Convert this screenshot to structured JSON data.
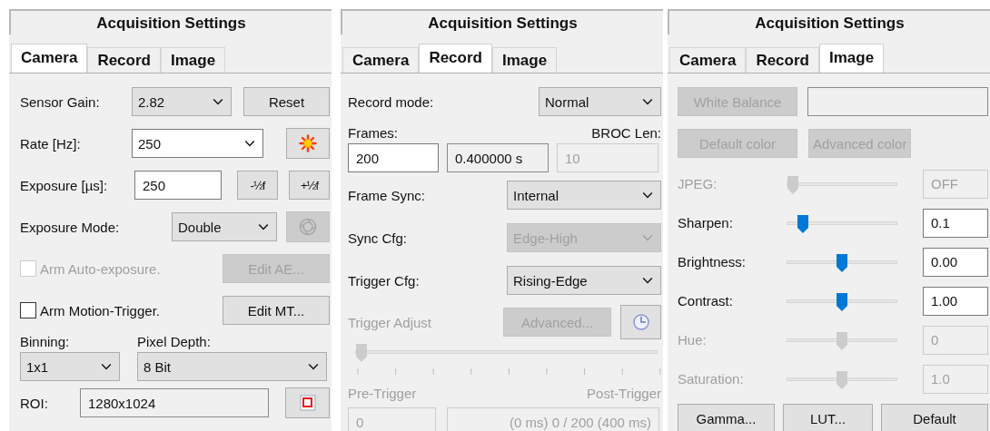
{
  "panels": [
    {
      "kind": "camera",
      "title": "Acquisition Settings",
      "tabs": [
        {
          "label": "Camera",
          "selected": true
        },
        {
          "label": "Record",
          "selected": false
        },
        {
          "label": "Image",
          "selected": false
        }
      ],
      "sensor_gain": {
        "label": "Sensor Gain:",
        "value": "2.82"
      },
      "reset_button": {
        "label": "Reset",
        "disabled": false
      },
      "rate": {
        "label": "Rate [Hz]:",
        "value": "250"
      },
      "exposure": {
        "label": "Exposure [µs]:",
        "value": "250"
      },
      "exposure_minus_button": {
        "label": "-½f",
        "disabled": false
      },
      "exposure_plus_button": {
        "label": "+½f",
        "disabled": false
      },
      "exposure_mode": {
        "label": "Exposure Mode:",
        "value": "Double"
      },
      "shutter_button": {
        "disabled": true
      },
      "auto_exposure": {
        "label": "Arm Auto-exposure.",
        "checked": false,
        "disabled": true
      },
      "edit_ae_button": {
        "label": "Edit AE...",
        "disabled": true
      },
      "motion_trigger": {
        "label": "Arm Motion-Trigger.",
        "checked": false,
        "disabled": false
      },
      "edit_mt_button": {
        "label": "Edit MT...",
        "disabled": false
      },
      "binning": {
        "label": "Binning:",
        "value": "1x1"
      },
      "pixel_depth": {
        "label": "Pixel Depth:",
        "value": "8 Bit"
      },
      "roi": {
        "label": "ROI:",
        "value": "1280x1024"
      }
    },
    {
      "kind": "record",
      "title": "Acquisition Settings",
      "tabs": [
        {
          "label": "Camera",
          "selected": false
        },
        {
          "label": "Record",
          "selected": true
        },
        {
          "label": "Image",
          "selected": false
        }
      ],
      "record_mode": {
        "label": "Record mode:",
        "value": "Normal"
      },
      "frames": {
        "label": "Frames:",
        "value": "200",
        "duration": "0.400000 s"
      },
      "broc_len": {
        "label": "BROC Len:",
        "value": "10",
        "disabled": true
      },
      "frame_sync": {
        "label": "Frame Sync:",
        "value": "Internal",
        "disabled": false
      },
      "sync_cfg": {
        "label": "Sync Cfg:",
        "value": "Edge-High",
        "disabled": true
      },
      "trigger_cfg": {
        "label": "Trigger Cfg:",
        "value": "Rising-Edge",
        "disabled": false
      },
      "trigger_adjust": {
        "label": "Trigger Adjust",
        "disabled": true,
        "level": 0
      },
      "advanced_button": {
        "label": "Advanced...",
        "disabled": true
      },
      "pre_trigger": {
        "label": "Pre-Trigger",
        "value": "0"
      },
      "post_trigger": {
        "label": "Post-Trigger",
        "value": "(0 ms) 0 / 200 (400 ms)"
      }
    },
    {
      "kind": "image",
      "title": "Acquisition Settings",
      "tabs": [
        {
          "label": "Camera",
          "selected": false
        },
        {
          "label": "Record",
          "selected": false
        },
        {
          "label": "Image",
          "selected": true
        }
      ],
      "white_balance_button": {
        "label": "White Balance",
        "disabled": true
      },
      "default_color_button": {
        "label": "Default color",
        "disabled": true
      },
      "advanced_color_button": {
        "label": "Advanced color",
        "disabled": true
      },
      "sliders": [
        {
          "label": "JPEG:",
          "level": 0,
          "value": "OFF",
          "disabled": true
        },
        {
          "label": "Sharpen:",
          "level": 0.1,
          "value": "0.1",
          "disabled": false
        },
        {
          "label": "Brightness:",
          "level": 0.5,
          "value": "0.00",
          "disabled": false
        },
        {
          "label": "Contrast:",
          "level": 0.5,
          "value": "1.00",
          "disabled": false
        },
        {
          "label": "Hue:",
          "level": 0.5,
          "value": "0",
          "disabled": true
        },
        {
          "label": "Saturation:",
          "level": 0.5,
          "value": "1.0",
          "disabled": true
        }
      ],
      "buttons": [
        {
          "label": "Gamma...",
          "disabled": false
        },
        {
          "label": "LUT...",
          "disabled": false
        },
        {
          "label": "Default",
          "disabled": false
        }
      ]
    }
  ]
}
